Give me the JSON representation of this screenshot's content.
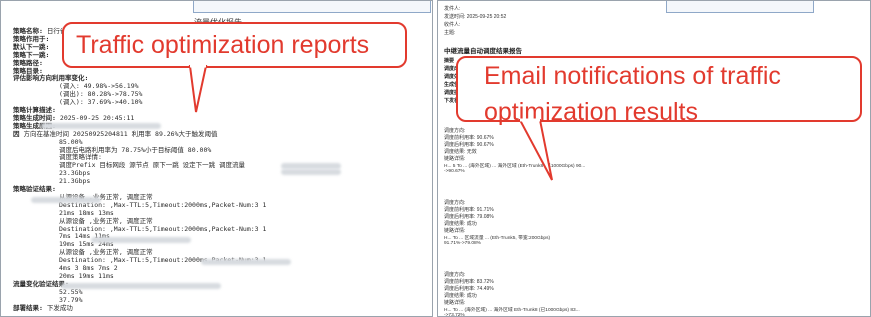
{
  "left_report": {
    "title": "流量优化报告",
    "lines": [
      {
        "label": "策略名称:",
        "value": "日行省厂西 09252045"
      },
      {
        "label": "策略作用于:",
        "value": ""
      },
      {
        "label": "默认下一跳:",
        "value": ""
      },
      {
        "label": "策略下一跳:",
        "value": ""
      },
      {
        "label": "策略路径:",
        "value": ""
      },
      {
        "label": "策略目录:",
        "value": ""
      },
      {
        "label": "评估影响方向利用率变化:",
        "value": ""
      },
      {
        "label": "",
        "value": "(调入: 49.98%->56.19%"
      },
      {
        "label": "",
        "value": "(调出): 80.28%->78.75%"
      },
      {
        "label": "",
        "value": "(调入): 37.69%->40.10%"
      },
      {
        "label": "策略计算描述:",
        "value": ""
      },
      {
        "label": "策略生成时间:",
        "value": "2025-09-25 20:45:11"
      },
      {
        "label": "策略生成原因:",
        "value": ""
      },
      {
        "label": "因",
        "value": "方向在基准时间 20250925204811 利用率 89.26%大于触发阈值"
      },
      {
        "label": "",
        "value": "85.00%"
      },
      {
        "label": "",
        "value": "调度后电路利用率为 78.75%小于目标阈值 80.00%"
      },
      {
        "label": "",
        "value": "调度策略详情:"
      },
      {
        "label": "",
        "value": "调度Prefix 目标网段 源节点 原下一跳 设定下一跳 调度流量"
      },
      {
        "label": "",
        "value": "23.3Gbps"
      },
      {
        "label": "",
        "value": "21.3Gbps"
      },
      {
        "label": "策略验证结果:",
        "value": ""
      },
      {
        "label": "",
        "value": "从源设备            ,业务正常, 调度正常"
      },
      {
        "label": "",
        "value": "Destination:         ,Max-TTL:5,Timeout:2000ms,Packet-Num:3 1"
      },
      {
        "label": "",
        "value": "21ms                    18ms                       13ms"
      },
      {
        "label": "",
        "value": "从源设备            ,业务正常, 调度正常"
      },
      {
        "label": "",
        "value": "Destination:         ,Max-TTL:5,Timeout:2000ms,Packet-Num:3 1"
      },
      {
        "label": "",
        "value": "7ms        14ms        11ms"
      },
      {
        "label": "",
        "value": "19ms              15ms              24ms"
      },
      {
        "label": "",
        "value": "从源设备            ,业务正常, 调度正常"
      },
      {
        "label": "",
        "value": "Destination:         ,Max-TTL:5,Timeout:2000ms,Packet-Num:3 1"
      },
      {
        "label": "",
        "value": "4ms        3 8ms        7ms 2"
      },
      {
        "label": "",
        "value": "20ms                 19ms                 11ms"
      },
      {
        "label": "流量变化验证结果:",
        "value": ""
      },
      {
        "label": "",
        "value": "52.55%"
      },
      {
        "label": "",
        "value": "37.79%"
      },
      {
        "label": "部署结果:",
        "value": "下发成功"
      }
    ],
    "callout": "Traffic optimization reports"
  },
  "right_email": {
    "meta": {
      "from_label": "发件人:",
      "sent_label": "发送时间:",
      "sent_value": "2025-09-25 20:52",
      "to_label": "收件人:",
      "subject_label": "主题:"
    },
    "heading": "中继流量自动调度结果报告",
    "summary": [
      {
        "label": "摘要",
        "value": ""
      },
      {
        "label": "调度成功方向数量:",
        "value": "4"
      },
      {
        "label": "调度失败方向数量:",
        "value": "4"
      },
      {
        "label": "生成告警数量:",
        "value": "4"
      },
      {
        "label": "调度执行时间:",
        "value": "17:50:01"
      },
      {
        "label": "下发状态:",
        "value": "成功"
      }
    ],
    "groups": [
      {
        "items": [
          "调度方向:",
          "调度前利用率: 90.67%",
          "调度后利用率: 90.67%",
          "调度结果: 无效",
          "链路详情:"
        ],
        "row": "H... 5 To ... (海外区域) ... 海外区域 (Eth-Trunk8 (已1000Gbps) 90...",
        "rate": "->90.67%"
      },
      {
        "items": [
          "调度方向:",
          "调度前利用率: 91.71%",
          "调度后利用率: 79.08%",
          "调度结果: 成功",
          "链路详情:"
        ],
        "row": "H... To ... 区域流量 ... (Eth-Trunk5, 带宽:200Gbps)",
        "rate": "91.71%->79.08%"
      },
      {
        "items": [
          "调度方向:",
          "调度前利用率: 83.72%",
          "调度后利用率: 74.49%",
          "调度结果: 成功",
          "链路详情:"
        ],
        "row": "H... To ... (海外区域) ... 海外区域 Eth-Trunk8 (已1000Gbps) 83...",
        "rate": "->73.72%",
        "row2": "H... To ... (海外区域) ... 海外区域 Eth-Trunk8 (已1000Gbps) 8...",
        "rate2": "->74.49%"
      }
    ],
    "callout_line1": "Email notifications of traffic",
    "callout_line2": "optimization results"
  },
  "colors": {
    "callout": "#e23a2e",
    "accent_orange": "#e07a1c",
    "border": "#9aa3ad"
  }
}
